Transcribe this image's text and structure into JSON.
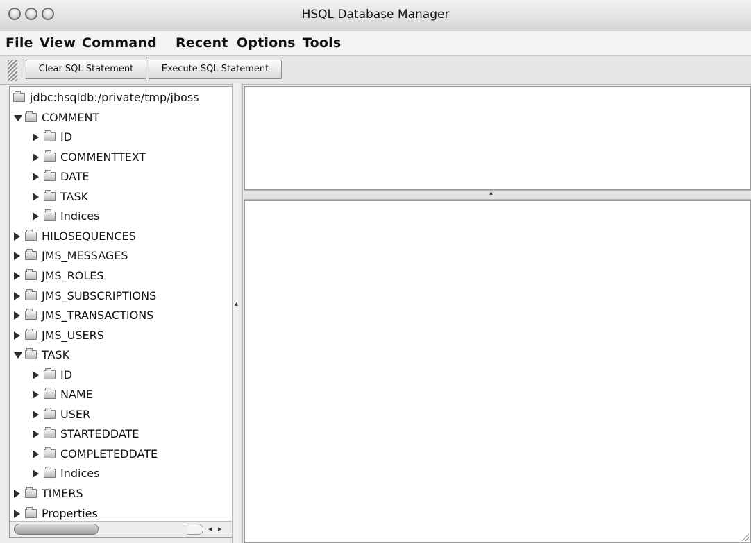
{
  "window": {
    "title": "HSQL Database Manager"
  },
  "menu": [
    "File",
    "View",
    "Command",
    "Recent",
    "Options",
    "Tools"
  ],
  "toolbar": {
    "clear_label": "Clear SQL Statement",
    "execute_label": "Execute SQL Statement"
  },
  "tree": [
    {
      "label": "jdbc:hsqldb:/private/tmp/jboss",
      "depth": 0,
      "state": "none"
    },
    {
      "label": "COMMENT",
      "depth": 1,
      "state": "expanded"
    },
    {
      "label": "ID",
      "depth": 2,
      "state": "collapsed"
    },
    {
      "label": "COMMENTTEXT",
      "depth": 2,
      "state": "collapsed"
    },
    {
      "label": "DATE",
      "depth": 2,
      "state": "collapsed"
    },
    {
      "label": "TASK",
      "depth": 2,
      "state": "collapsed"
    },
    {
      "label": "Indices",
      "depth": 2,
      "state": "collapsed"
    },
    {
      "label": "HILOSEQUENCES",
      "depth": 1,
      "state": "collapsed"
    },
    {
      "label": "JMS_MESSAGES",
      "depth": 1,
      "state": "collapsed"
    },
    {
      "label": "JMS_ROLES",
      "depth": 1,
      "state": "collapsed"
    },
    {
      "label": "JMS_SUBSCRIPTIONS",
      "depth": 1,
      "state": "collapsed"
    },
    {
      "label": "JMS_TRANSACTIONS",
      "depth": 1,
      "state": "collapsed"
    },
    {
      "label": "JMS_USERS",
      "depth": 1,
      "state": "collapsed"
    },
    {
      "label": "TASK",
      "depth": 1,
      "state": "expanded"
    },
    {
      "label": "ID",
      "depth": 2,
      "state": "collapsed"
    },
    {
      "label": "NAME",
      "depth": 2,
      "state": "collapsed"
    },
    {
      "label": "USER",
      "depth": 2,
      "state": "collapsed"
    },
    {
      "label": "STARTEDDATE",
      "depth": 2,
      "state": "collapsed"
    },
    {
      "label": "COMPLETEDDATE",
      "depth": 2,
      "state": "collapsed"
    },
    {
      "label": "Indices",
      "depth": 2,
      "state": "collapsed"
    },
    {
      "label": "TIMERS",
      "depth": 1,
      "state": "collapsed"
    },
    {
      "label": "Properties",
      "depth": 1,
      "state": "collapsed"
    }
  ],
  "icons": {
    "tree_node": "folder-icon",
    "expanded": "disclosure-expanded-icon",
    "collapsed": "disclosure-collapsed-icon",
    "scroll_left": "◂",
    "scroll_right": "▸",
    "divider_arrow": "▴"
  },
  "colors": {
    "window_bg": "#ececec",
    "pane_bg": "#ffffff"
  }
}
